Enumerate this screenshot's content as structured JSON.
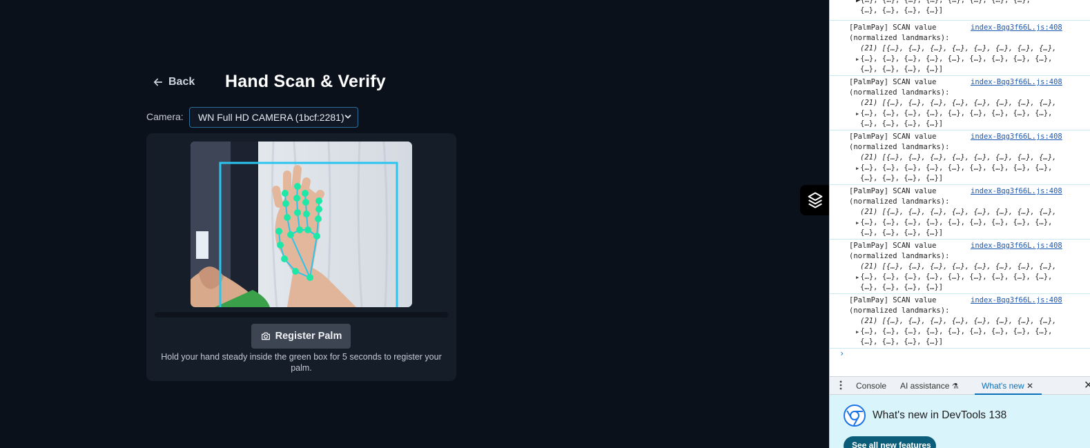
{
  "app": {
    "back_label": "Back",
    "title": "Hand Scan & Verify",
    "camera_label": "Camera:",
    "camera_value": "WN Full HD CAMERA (1bcf:2281)",
    "register_label": "Register Palm",
    "hint": "Hold your hand steady inside the green box for 5 seconds to register your palm.",
    "progress": 0,
    "accent_color": "#29c4ef",
    "landmark_color": "#1de8a8"
  },
  "devtools": {
    "first_partial": {
      "line_a": "{…}, {…}, {…}, {…}, {…}, {…}, {…}, {…},",
      "line_b": "{…}, {…}, {…}, {…}]"
    },
    "logs": [
      {
        "line1": "[PalmPay] SCAN value",
        "line2": "(normalized landmarks):",
        "source": "index-Bqg3f66L.js:408",
        "array_line1": "(21) [{…}, {…}, {…}, {…}, {…}, {…}, {…}, {…},",
        "array_line2": "{…}, {…}, {…}, {…}, {…}, {…}, {…}, {…}, {…},",
        "array_line3": "{…}, {…}, {…}, {…}]"
      },
      {
        "line1": "[PalmPay] SCAN value",
        "line2": "(normalized landmarks):",
        "source": "index-Bqg3f66L.js:408",
        "array_line1": "(21) [{…}, {…}, {…}, {…}, {…}, {…}, {…}, {…},",
        "array_line2": "{…}, {…}, {…}, {…}, {…}, {…}, {…}, {…}, {…},",
        "array_line3": "{…}, {…}, {…}, {…}]"
      },
      {
        "line1": "[PalmPay] SCAN value",
        "line2": "(normalized landmarks):",
        "source": "index-Bqg3f66L.js:408",
        "array_line1": "(21) [{…}, {…}, {…}, {…}, {…}, {…}, {…}, {…},",
        "array_line2": "{…}, {…}, {…}, {…}, {…}, {…}, {…}, {…}, {…},",
        "array_line3": "{…}, {…}, {…}, {…}]"
      },
      {
        "line1": "[PalmPay] SCAN value",
        "line2": "(normalized landmarks):",
        "source": "index-Bqg3f66L.js:408",
        "array_line1": "(21) [{…}, {…}, {…}, {…}, {…}, {…}, {…}, {…},",
        "array_line2": "{…}, {…}, {…}, {…}, {…}, {…}, {…}, {…}, {…},",
        "array_line3": "{…}, {…}, {…}, {…}]"
      },
      {
        "line1": "[PalmPay] SCAN value",
        "line2": "(normalized landmarks):",
        "source": "index-Bqg3f66L.js:408",
        "array_line1": "(21) [{…}, {…}, {…}, {…}, {…}, {…}, {…}, {…},",
        "array_line2": "{…}, {…}, {…}, {…}, {…}, {…}, {…}, {…}, {…},",
        "array_line3": "{…}, {…}, {…}, {…}]"
      },
      {
        "line1": "[PalmPay] SCAN value",
        "line2": "(normalized landmarks):",
        "source": "index-Bqg3f66L.js:408",
        "array_line1": "(21) [{…}, {…}, {…}, {…}, {…}, {…}, {…}, {…},",
        "array_line2": "{…}, {…}, {…}, {…}, {…}, {…}, {…}, {…}, {…},",
        "array_line3": "{…}, {…}, {…}, {…}]"
      }
    ],
    "prompt": "›",
    "tabs": {
      "console": "Console",
      "ai": "AI assistance",
      "whatsnew": "What's new"
    },
    "whatsnew_title": "What's new in DevTools 138",
    "see_all": "See all new features",
    "accent": "#0b6fb8"
  }
}
